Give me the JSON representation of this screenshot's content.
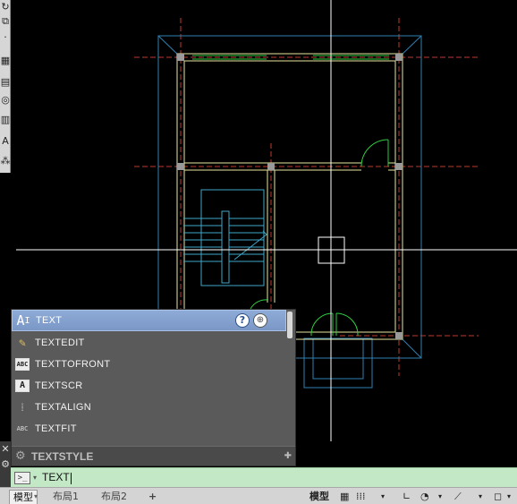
{
  "colors": {
    "canvas_bg": "#000000",
    "wall_yellow": "#e6e6a0",
    "axis_red": "#c0392b",
    "outline_blue": "#2f7fb0",
    "window_green": "#2ecc40",
    "stair_cyan": "#3fa7c9",
    "crosshair": "#ffffff"
  },
  "autocomplete": {
    "items": [
      {
        "icon": "text-icon",
        "glyph": "A",
        "label": "TEXT",
        "selected": true
      },
      {
        "icon": "textedit-icon",
        "glyph": "✎",
        "label": "TEXTEDIT",
        "selected": false
      },
      {
        "icon": "texttofront-icon",
        "glyph": "ABC",
        "label": "TEXTTOFRONT",
        "selected": false
      },
      {
        "icon": "textscr-icon",
        "glyph": "A",
        "label": "TEXTSCR",
        "selected": false
      },
      {
        "icon": "textalign-icon",
        "glyph": "⁞",
        "label": "TEXTALIGN",
        "selected": false
      },
      {
        "icon": "textfit-icon",
        "glyph": "ABC",
        "label": "TEXTFIT",
        "selected": false
      }
    ],
    "footer_label": "TEXTSTYLE"
  },
  "command_line": {
    "prompt_glyph": ">_",
    "value": "TEXT"
  },
  "status_bar": {
    "model_tab": "模型",
    "layout1_tab": "布局1",
    "layout2_tab": "布局2",
    "add_tab_glyph": "+",
    "model_button": "模型"
  }
}
